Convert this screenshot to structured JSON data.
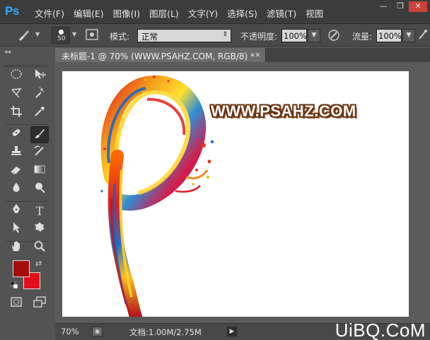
{
  "app": {
    "logo": "Ps"
  },
  "menu": [
    "文件(F)",
    "编辑(E)",
    "图像(I)",
    "图层(L)",
    "文字(Y)",
    "选择(S)",
    "滤镜(T)",
    "视图"
  ],
  "window_controls": {
    "minimize": "—",
    "restore": "❐",
    "close": "✕"
  },
  "options": {
    "brush_size": "50",
    "mode_label": "模式:",
    "mode_value": "正常",
    "opacity_label": "不透明度:",
    "opacity_value": "100%",
    "flow_label": "流量:",
    "flow_value": "100%"
  },
  "document": {
    "tab_title": "未标题-1 @ 70% (WWW.PSAHZ.COM, RGB/8) *",
    "canvas_text": "WWW.PSAHZ.COM"
  },
  "status": {
    "zoom": "70%",
    "doc_info": "文档:1.00M/2.75M"
  },
  "watermark": "UiBQ.CoM",
  "colors": {
    "foreground": "#a50b0b",
    "background": "#e10e1a",
    "ps_blue": "#31a8ff"
  },
  "tools": [
    "marquee-icon",
    "move-icon",
    "lasso-icon",
    "magic-wand-icon",
    "crop-icon",
    "eyedropper-icon",
    "healing-brush-icon",
    "brush-icon",
    "clone-stamp-icon",
    "history-brush-icon",
    "eraser-icon",
    "gradient-icon",
    "blur-icon",
    "dodge-icon",
    "pen-icon",
    "type-icon",
    "path-selection-icon",
    "shape-icon",
    "hand-icon",
    "zoom-icon",
    "quick-mask-icon",
    "screen-mode-icon"
  ]
}
